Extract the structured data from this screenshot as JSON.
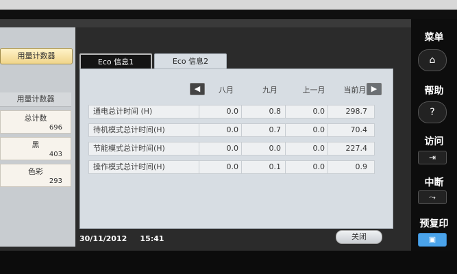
{
  "left_panel": {
    "top_tab": "用量计数器",
    "header": "用量计数器",
    "counters": [
      {
        "label": "总计数",
        "value": "696"
      },
      {
        "label": "黑",
        "value": "403"
      },
      {
        "label": "色彩",
        "value": "293"
      }
    ]
  },
  "tabs": [
    {
      "label": "Eco 信息1"
    },
    {
      "label": "Eco 信息2"
    }
  ],
  "table": {
    "columns": [
      "八月",
      "九月",
      "上一月",
      "当前月"
    ],
    "rows": [
      {
        "label": "通电总计时间 (H)",
        "values": [
          "0.0",
          "0.8",
          "0.0",
          "298.7"
        ]
      },
      {
        "label": "待机模式总计时间(H)",
        "values": [
          "0.0",
          "0.7",
          "0.0",
          "70.4"
        ]
      },
      {
        "label": "节能模式总计时间(H)",
        "values": [
          "0.0",
          "0.0",
          "0.0",
          "227.4"
        ]
      },
      {
        "label": "操作模式总计时间(H)",
        "values": [
          "0.0",
          "0.1",
          "0.0",
          "0.9"
        ]
      }
    ]
  },
  "status": {
    "date": "30/11/2012",
    "time": "15:41",
    "close_label": "关闭"
  },
  "hardware": {
    "menu_label": "菜单",
    "help_label": "帮助",
    "access_label": "访问",
    "interrupt_label": "中断",
    "preview_label": "预复印"
  },
  "icons": [
    "home-icon",
    "help-icon",
    "access-icon",
    "interrupt-icon",
    "preview-icon",
    "arrow-left-icon",
    "arrow-right-icon"
  ]
}
